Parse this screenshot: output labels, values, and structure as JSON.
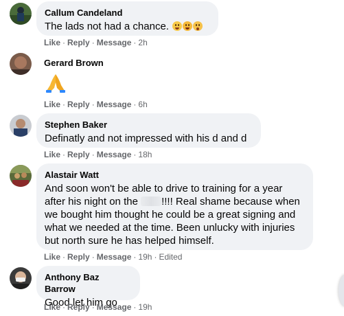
{
  "comments": [
    {
      "author": "Callum Candeland",
      "text": "The lads not had a chance.",
      "emojis": [
        "grimacing-face-icon",
        "tears-of-joy-icon",
        "flushed-face-icon"
      ],
      "like": "Like",
      "reply": "Reply",
      "message": "Message",
      "time": "2h"
    },
    {
      "author": "Gerard Brown",
      "emoji": "folded-hands-icon",
      "like": "Like",
      "reply": "Reply",
      "message": "Message",
      "time": "6h"
    },
    {
      "author": "Stephen Baker",
      "text": "Definatly and not impressed with his d and d",
      "like": "Like",
      "reply": "Reply",
      "message": "Message",
      "time": "18h"
    },
    {
      "author": "Alastair Watt",
      "text_before": "And soon won't be able to drive to training for a year after his night on the ",
      "text_after": "!!!! Real shame because when we bought him thought he could be a great signing and what we needed at the time. Been unlucky with injuries but north sure he has helped himself.",
      "like": "Like",
      "reply": "Reply",
      "message": "Message",
      "time": "19h",
      "edited": "Edited"
    },
    {
      "author": "Anthony Baz Barrow",
      "text": "Good let him go",
      "like": "Like",
      "reply": "Reply",
      "message": "Message",
      "time": "19h"
    }
  ],
  "colors": {
    "bubble": "#f0f2f5",
    "meta": "#65676b",
    "text": "#050505"
  }
}
